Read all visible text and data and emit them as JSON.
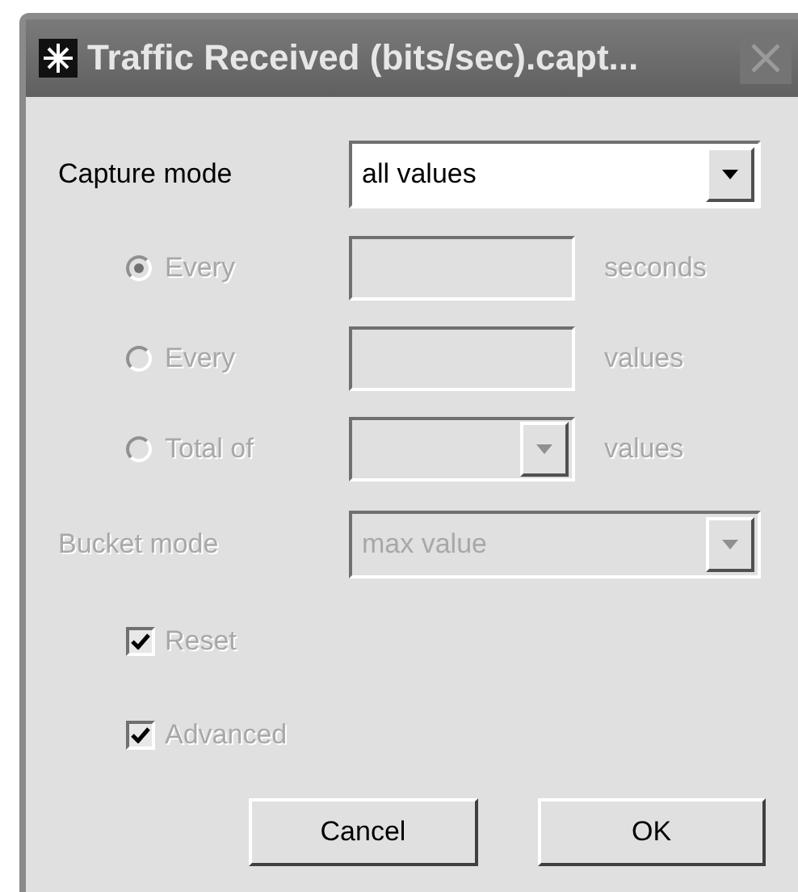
{
  "window": {
    "title": "Traffic Received (bits/sec).capt...",
    "close_disabled": true
  },
  "capture_mode": {
    "label": "Capture mode",
    "value": "all values",
    "disabled": false
  },
  "options": [
    {
      "kind": "text",
      "label": "Every",
      "unit": "seconds",
      "selected": true,
      "disabled": true
    },
    {
      "kind": "text",
      "label": "Every",
      "unit": "values",
      "selected": false,
      "disabled": true
    },
    {
      "kind": "combo",
      "label": "Total of",
      "unit": "values",
      "selected": false,
      "disabled": true
    }
  ],
  "bucket_mode": {
    "label": "Bucket mode",
    "value": "max value",
    "disabled": true
  },
  "checkboxes": [
    {
      "label": "Reset",
      "checked": true,
      "disabled": true
    },
    {
      "label": "Advanced",
      "checked": true,
      "disabled": true
    }
  ],
  "buttons": [
    {
      "label": "Cancel"
    },
    {
      "label": "OK"
    }
  ]
}
